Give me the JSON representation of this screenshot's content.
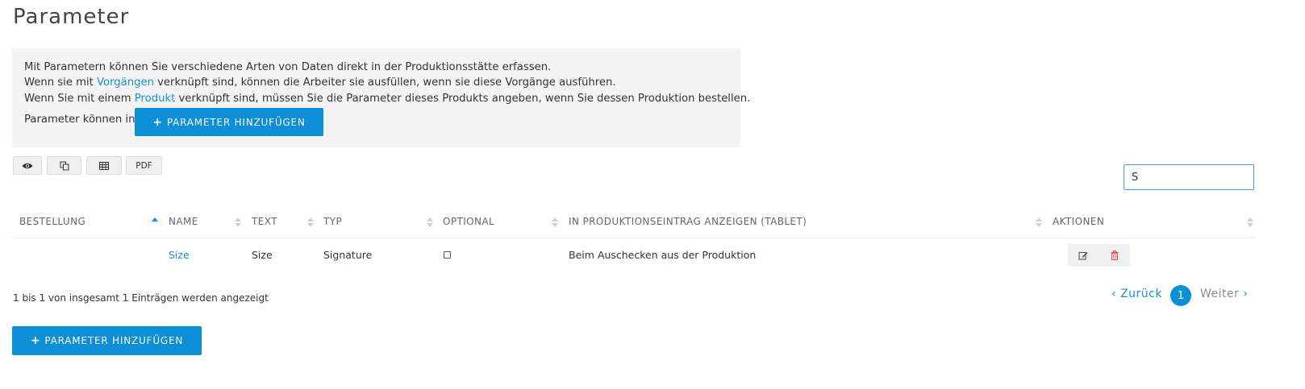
{
  "page": {
    "title": "Parameter"
  },
  "info": {
    "line1": "Mit Parametern können Sie verschiedene Arten von Daten direkt in der Produktionsstätte erfassen.",
    "line2_pre": "Wenn sie mit ",
    "line2_link": "Vorgängen",
    "line2_post": " verknüpft sind, können die Arbeiter sie ausfüllen, wenn sie diese Vorgänge ausführen.",
    "line3_pre": "Wenn Sie mit einem ",
    "line3_link": "Produkt",
    "line3_post": " verknüpft sind, müssen Sie die Parameter dieses Produkts angeben, wenn Sie dessen Produktion bestellen.",
    "line4": "Parameter können in",
    "add_button": "PARAMETER HINZUFÜGEN"
  },
  "toolbar": {
    "view_icon": "eye-icon",
    "copy_icon": "copy-icon",
    "table_icon": "table-icon",
    "pdf_label": "PDF"
  },
  "search": {
    "value": "S"
  },
  "table": {
    "headers": [
      "BESTELLUNG",
      "NAME",
      "TEXT",
      "TYP",
      "OPTIONAL",
      "IN PRODUKTIONSEINTRAG ANZEIGEN (TABLET)",
      "AKTIONEN"
    ],
    "rows": [
      {
        "bestellung": "",
        "name": "Size",
        "text": "Size",
        "typ": "Signature",
        "optional": false,
        "anzeigen": "Beim Auschecken aus der Produktion"
      }
    ]
  },
  "footer": {
    "summary": "1 bis 1 von insgesamt 1 Einträgen werden angezeigt",
    "prev": "Zurück",
    "next": "Weiter",
    "current_page": "1",
    "add_button": "PARAMETER HINZUFÜGEN"
  },
  "colors": {
    "accent": "#0d8fd7",
    "link": "#1a8fd6",
    "info_bg": "#f4f4f4",
    "delete": "#e05050"
  }
}
